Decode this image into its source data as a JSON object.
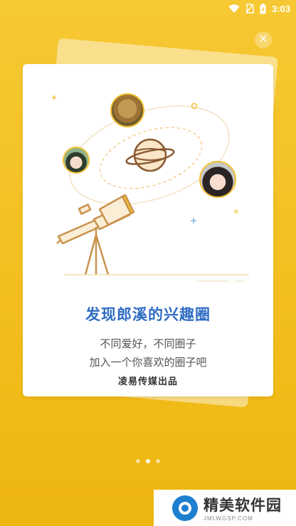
{
  "status_bar": {
    "time": "3:03",
    "icons": [
      "wifi-icon",
      "no-sim-icon",
      "battery-charging-icon"
    ]
  },
  "close_button": {
    "icon": "close-icon",
    "label": "✕"
  },
  "card": {
    "headline": "发现郎溪的兴趣圈",
    "subtitle_line1": "不同爱好，不同圈子",
    "subtitle_line2": "加入一个你喜欢的圈子吧",
    "publisher": "凌易传媒出品"
  },
  "pager": {
    "total": 3,
    "active": 1
  },
  "watermark": {
    "name": "精美软件园",
    "url": "JMLWGSP.COM"
  },
  "colors": {
    "background": "#f3bf1f",
    "headline": "#2f6cc4",
    "accent_yellow": "#f4c033",
    "telescope_line": "#d79a57"
  }
}
